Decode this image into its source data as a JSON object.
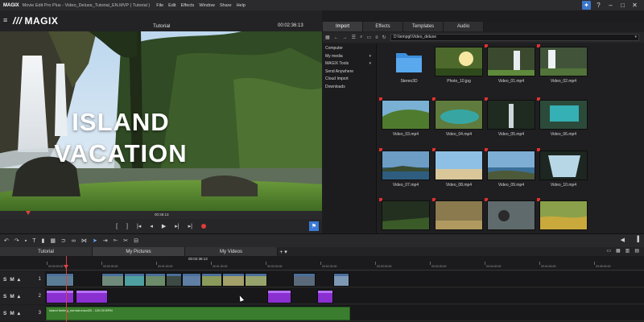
{
  "window": {
    "logo": "MAGIX",
    "title": "Movie Edit Pro Plus - Video_Deluxe_Tutorial_EN.MVP ( Tutorial )",
    "menu": [
      "File",
      "Edit",
      "Effects",
      "Window",
      "Share",
      "Help"
    ]
  },
  "preview": {
    "brand": "MAGIX",
    "title": "Tutorial",
    "timecode": "00:02:36:13",
    "overlay_line1": "ISLAND",
    "overlay_line2": "VACATION",
    "scrub_time": "00:36:13"
  },
  "transport": {
    "buttons": [
      "[",
      "]",
      "|◂",
      "◂",
      "▶",
      "▸|",
      "▸|"
    ]
  },
  "media_pool": {
    "tabs": [
      "Import",
      "Effects",
      "Templates",
      "Audio"
    ],
    "active_tab": "Import",
    "path": "D:\\tempgi\\Video_deluxe",
    "sidebar": [
      {
        "label": "Computer",
        "caret": ""
      },
      {
        "label": "My media",
        "caret": "▾"
      },
      {
        "label": "MAGIX Tools",
        "caret": "▾"
      },
      {
        "label": "Send Anywhere",
        "caret": ""
      },
      {
        "label": "Cloud Import",
        "caret": ""
      },
      {
        "label": "Downloads",
        "caret": ""
      }
    ],
    "items": [
      {
        "label": "Stereo3D",
        "type": "folder"
      },
      {
        "label": "Photo_10.jpg",
        "type": "sun"
      },
      {
        "label": "Video_01.mp4",
        "type": "fall"
      },
      {
        "label": "Video_02.mp4",
        "type": "fall2"
      },
      {
        "label": "Video_03.mp4",
        "type": "green"
      },
      {
        "label": "Video_04.mp4",
        "type": "lake"
      },
      {
        "label": "Video_05.mp4",
        "type": "dark"
      },
      {
        "label": "Video_06.mp4",
        "type": "teal"
      },
      {
        "label": "Video_07.mp4",
        "type": "sea"
      },
      {
        "label": "Video_08.mp4",
        "type": "beach"
      },
      {
        "label": "Video_09.mp4",
        "type": "coast"
      },
      {
        "label": "Video_10.mp4",
        "type": "cave"
      },
      {
        "label": "",
        "type": "forest"
      },
      {
        "label": "",
        "type": "dry"
      },
      {
        "label": "",
        "type": "person"
      },
      {
        "label": "",
        "type": "moss"
      }
    ]
  },
  "project_tabs": {
    "tabs": [
      "Tutorial",
      "My Pictures",
      "My Videos"
    ],
    "active": "My Pictures",
    "add": "+ ▾"
  },
  "timeline": {
    "position": "00:02:36:13",
    "ruler_ticks": [
      "00:00:00:00",
      "00:00:30:00",
      "00:01:00:00",
      "00:01:30:00",
      "00:02:00:00",
      "00:02:30:00",
      "00:03:00:00",
      "00:03:30:00",
      "00:04:00:00",
      "00:04:30:00",
      "00:05:00:00"
    ],
    "tracks": [
      {
        "number": "1",
        "s": "S",
        "m": "M"
      },
      {
        "number": "2",
        "s": "S",
        "m": "M"
      },
      {
        "number": "3",
        "s": "S",
        "m": "M"
      }
    ],
    "audio_clip_name": "Island feeling_normal.mscd20 - 120.00 BPM"
  },
  "colors": {
    "accent": "#3d77c9",
    "record": "#e03a3a",
    "clip_purple": "#8a2fd0",
    "clip_audio": "#3b7d2e"
  }
}
